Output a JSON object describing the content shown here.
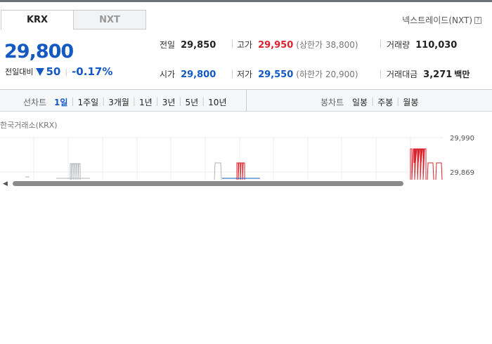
{
  "tabs": {
    "krx": "KRX",
    "nxt": "NXT"
  },
  "nxt_link": "넥스트레이드(NXT)",
  "quote": {
    "price": "29,800",
    "change_label": "전일대비",
    "change_value": "50",
    "change_pct": "-0.17%"
  },
  "stats": {
    "prev_close": {
      "label": "전일",
      "value": "29,850"
    },
    "high": {
      "label": "고가",
      "value": "29,950",
      "sub": "(상한가 38,800)"
    },
    "volume": {
      "label": "거래량",
      "value": "110,030"
    },
    "open": {
      "label": "시가",
      "value": "29,800"
    },
    "low": {
      "label": "저가",
      "value": "29,550",
      "sub": "(하한가 20,900)"
    },
    "amount": {
      "label": "거래대금",
      "value": "3,271",
      "unit": "백만"
    }
  },
  "toolbar": {
    "line_chart_label": "선차트",
    "periods": [
      "1일",
      "1주일",
      "3개월",
      "1년",
      "3년",
      "5년",
      "10년"
    ],
    "selected_period": "1일",
    "candle_chart_label": "봉차트",
    "candle_periods": [
      "일봉",
      "주봉",
      "월봉"
    ]
  },
  "chart_data": {
    "type": "line",
    "title": "한국거래소(KRX)",
    "y_ticks": [
      "29,990",
      "29,869"
    ],
    "ylim": [
      29869,
      29990
    ],
    "gridlines": true
  },
  "colors": {
    "up": "#d9232d",
    "down": "#1259c3",
    "flat": "#b0b3b8"
  }
}
